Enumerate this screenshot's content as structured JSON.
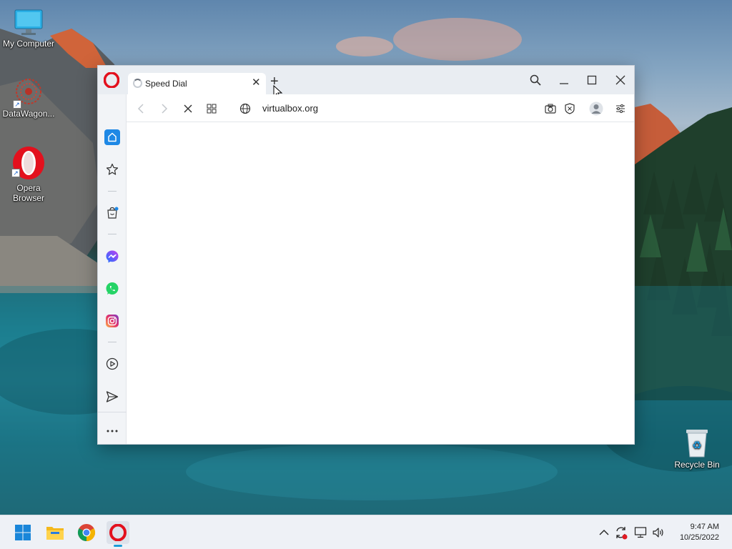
{
  "desktop": {
    "icons": [
      {
        "label": "My Computer"
      },
      {
        "label": "DataWagon..."
      },
      {
        "label": "Opera Browser"
      },
      {
        "label": "Recycle Bin"
      }
    ]
  },
  "browser": {
    "tab": {
      "title": "Speed Dial",
      "loading": true
    },
    "address_bar": {
      "url": "virtualbox.org"
    },
    "sidebar": [
      "home-icon",
      "bookmarks-icon",
      "shopping-icon",
      "messenger-icon",
      "whatsapp-icon",
      "instagram-icon",
      "player-icon",
      "send-icon",
      "more-icon"
    ],
    "accent": "#1e88e5"
  },
  "taskbar": {
    "apps": [
      "start",
      "file-explorer",
      "chrome",
      "opera"
    ],
    "clock": {
      "time": "9:47 AM",
      "date": "10/25/2022"
    }
  }
}
